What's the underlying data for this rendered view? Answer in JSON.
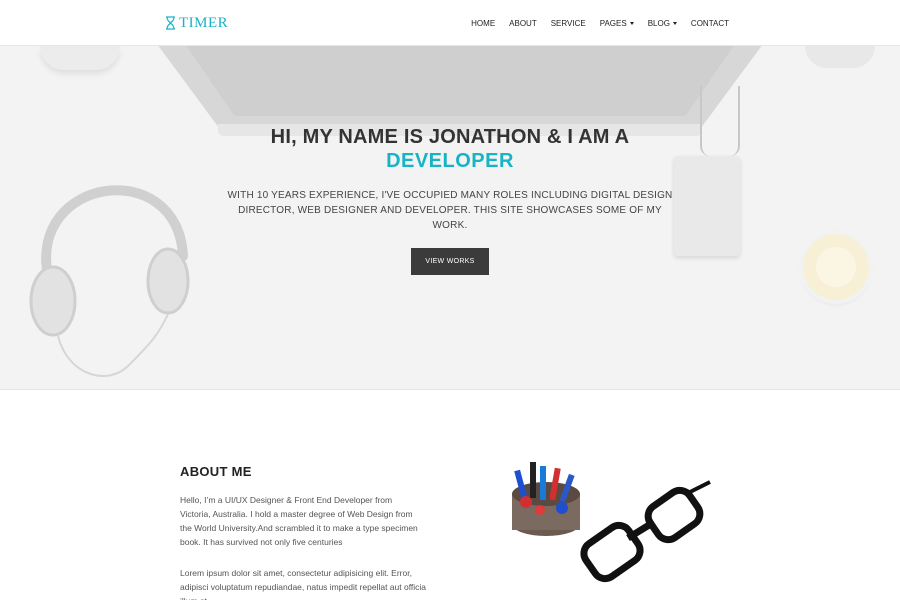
{
  "brand": {
    "name": "TIMER",
    "color": "#17b3c6"
  },
  "nav": {
    "items": [
      {
        "label": "HOME",
        "dropdown": false
      },
      {
        "label": "ABOUT",
        "dropdown": false
      },
      {
        "label": "SERVICE",
        "dropdown": false
      },
      {
        "label": "PAGES",
        "dropdown": true
      },
      {
        "label": "BLOG",
        "dropdown": true
      },
      {
        "label": "CONTACT",
        "dropdown": false
      }
    ]
  },
  "hero": {
    "title": "HI, MY NAME IS JONATHON & I AM A",
    "role": "DEVELOPER",
    "description": "WITH 10 YEARS EXPERIENCE, I'VE OCCUPIED MANY ROLES INCLUDING DIGITAL DESIGN DIRECTOR, WEB DESIGNER AND DEVELOPER. THIS SITE SHOWCASES SOME OF MY WORK.",
    "button_label": "VIEW WORKS"
  },
  "about": {
    "title": "ABOUT ME",
    "paragraph1": "Hello, I’m a UI/UX Designer & Front End Developer from Victoria, Australia. I hold a master degree of Web Design from the World University.And scrambled it to make a type specimen book. It has survived not only five centuries",
    "paragraph2": "Lorem ipsum dolor sit amet, consectetur adipisicing elit. Error, adipisci voluptatum repudiandae, natus impedit repellat aut officia illum at"
  },
  "colors": {
    "accent": "#17b3c6",
    "button": "#3b3b3b",
    "hero_bg": "#f3f3f3"
  }
}
